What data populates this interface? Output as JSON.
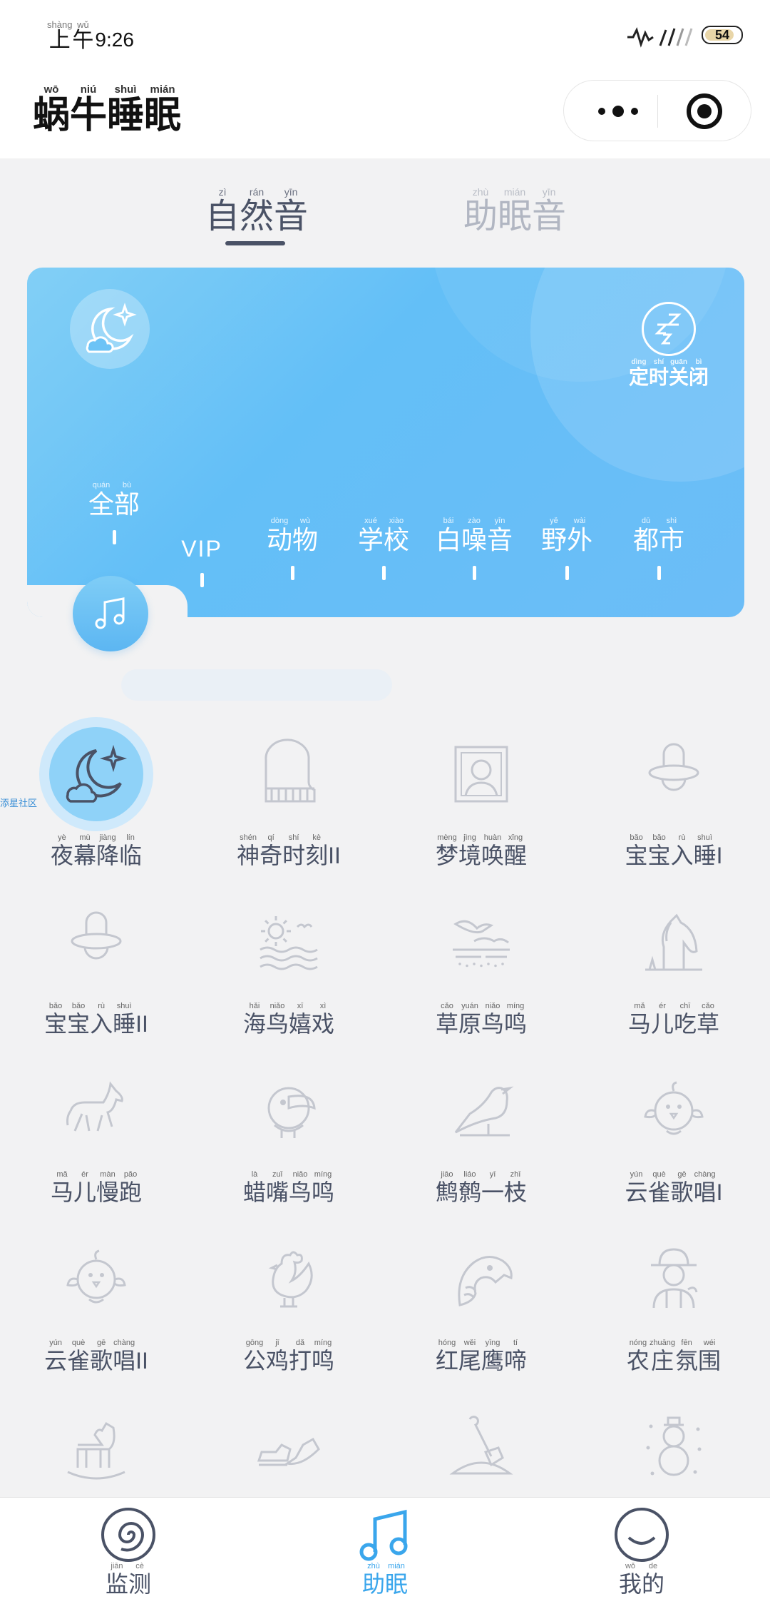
{
  "status": {
    "time_prefix": "上午",
    "time_prefix_pinyin": [
      "shàng",
      "wǔ"
    ],
    "time": "9:26",
    "battery": "54"
  },
  "header": {
    "title_chars": [
      "蜗",
      "牛",
      "睡",
      "眠"
    ],
    "title_pinyin": [
      "wō",
      "niú",
      "shuì",
      "mián"
    ]
  },
  "tabs": [
    {
      "chars": [
        "自",
        "然",
        "音"
      ],
      "pinyin": [
        "zì",
        "rán",
        "yīn"
      ],
      "active": true
    },
    {
      "chars": [
        "助",
        "眠",
        "音"
      ],
      "pinyin": [
        "zhù",
        "mián",
        "yīn"
      ],
      "active": false
    }
  ],
  "card": {
    "timer": {
      "chars": [
        "定",
        "时",
        "关",
        "闭"
      ],
      "pinyin": [
        "dìng",
        "shí",
        "guān",
        "bì"
      ]
    },
    "categories": [
      {
        "chars": [
          "全",
          "部"
        ],
        "pinyin": [
          "quán",
          "bù"
        ],
        "active": true
      },
      {
        "chars": [
          "VIP"
        ],
        "pinyin": [
          ""
        ],
        "active": false
      },
      {
        "chars": [
          "动",
          "物"
        ],
        "pinyin": [
          "dòng",
          "wù"
        ],
        "active": false
      },
      {
        "chars": [
          "学",
          "校"
        ],
        "pinyin": [
          "xué",
          "xiào"
        ],
        "active": false
      },
      {
        "chars": [
          "白",
          "噪",
          "音"
        ],
        "pinyin": [
          "bái",
          "zào",
          "yīn"
        ],
        "active": false
      },
      {
        "chars": [
          "野",
          "外"
        ],
        "pinyin": [
          "yě",
          "wài"
        ],
        "active": false
      },
      {
        "chars": [
          "都",
          "市"
        ],
        "pinyin": [
          "dū",
          "shì"
        ],
        "active": false
      }
    ]
  },
  "side_link": "添星社区",
  "sounds": [
    {
      "icon": "moon-icon",
      "chars": [
        "夜",
        "幕",
        "降",
        "临"
      ],
      "pinyin": [
        "yè",
        "mù",
        "jiàng",
        "lín"
      ],
      "active": true
    },
    {
      "icon": "piano-icon",
      "chars": [
        "神",
        "奇",
        "时",
        "刻",
        " II"
      ],
      "pinyin": [
        "shén",
        "qí",
        "shí",
        "kè",
        ""
      ]
    },
    {
      "icon": "portrait-icon",
      "chars": [
        "梦",
        "境",
        "唤",
        "醒"
      ],
      "pinyin": [
        "mèng",
        "jìng",
        "huàn",
        "xǐng"
      ]
    },
    {
      "icon": "pacifier-icon",
      "chars": [
        "宝",
        "宝",
        "入",
        "睡",
        " I"
      ],
      "pinyin": [
        "bǎo",
        "bǎo",
        "rù",
        "shuì",
        ""
      ]
    },
    {
      "icon": "pacifier-icon",
      "chars": [
        "宝",
        "宝",
        "入",
        "睡",
        " II"
      ],
      "pinyin": [
        "bǎo",
        "bǎo",
        "rù",
        "shuì",
        ""
      ]
    },
    {
      "icon": "seaside-icon",
      "chars": [
        "海",
        "鸟",
        "嬉",
        "戏"
      ],
      "pinyin": [
        "hǎi",
        "niǎo",
        "xī",
        "xì"
      ]
    },
    {
      "icon": "grassland-bird-icon",
      "chars": [
        "草",
        "原",
        "鸟",
        "鸣"
      ],
      "pinyin": [
        "cǎo",
        "yuán",
        "niǎo",
        "míng"
      ]
    },
    {
      "icon": "horse-head-icon",
      "chars": [
        "马",
        "儿",
        "吃",
        "草"
      ],
      "pinyin": [
        "mǎ",
        "ér",
        "chī",
        "cǎo"
      ]
    },
    {
      "icon": "running-horse-icon",
      "chars": [
        "马",
        "儿",
        "慢",
        "跑"
      ],
      "pinyin": [
        "mǎ",
        "ér",
        "màn",
        "pǎo"
      ]
    },
    {
      "icon": "toucan-icon",
      "chars": [
        "蜡",
        "嘴",
        "鸟",
        "鸣"
      ],
      "pinyin": [
        "là",
        "zuǐ",
        "niǎo",
        "míng"
      ]
    },
    {
      "icon": "magpie-icon",
      "chars": [
        "鹪",
        "鹩",
        "一",
        "枝"
      ],
      "pinyin": [
        "jiāo",
        "liáo",
        "yī",
        "zhī"
      ]
    },
    {
      "icon": "chick-icon",
      "chars": [
        "云",
        "雀",
        "歌",
        "唱",
        " I"
      ],
      "pinyin": [
        "yún",
        "què",
        "gē",
        "chàng",
        ""
      ]
    },
    {
      "icon": "chick-icon",
      "chars": [
        "云",
        "雀",
        "歌",
        "唱",
        " II"
      ],
      "pinyin": [
        "yún",
        "què",
        "gē",
        "chàng",
        ""
      ]
    },
    {
      "icon": "rooster-icon",
      "chars": [
        "公",
        "鸡",
        "打",
        "鸣"
      ],
      "pinyin": [
        "gōng",
        "jī",
        "dǎ",
        "míng"
      ]
    },
    {
      "icon": "eagle-icon",
      "chars": [
        "红",
        "尾",
        "鹰",
        "啼"
      ],
      "pinyin": [
        "hóng",
        "wěi",
        "yīng",
        "tí"
      ]
    },
    {
      "icon": "farmer-icon",
      "chars": [
        "农",
        "庄",
        "氛",
        "围"
      ],
      "pinyin": [
        "nóng",
        "zhuāng",
        "fēn",
        "wéi"
      ]
    },
    {
      "icon": "rocking-horse-icon",
      "chars": [],
      "pinyin": []
    },
    {
      "icon": "sneakers-icon",
      "chars": [],
      "pinyin": []
    },
    {
      "icon": "shovel-icon",
      "chars": [],
      "pinyin": []
    },
    {
      "icon": "snowman-icon",
      "chars": [],
      "pinyin": []
    }
  ],
  "bottom_nav": [
    {
      "icon": "spiral-icon",
      "chars": [
        "监",
        "测"
      ],
      "pinyin": [
        "jiān",
        "cè"
      ],
      "active": false
    },
    {
      "icon": "music-note-icon",
      "chars": [
        "助",
        "眠"
      ],
      "pinyin": [
        "zhù",
        "mián"
      ],
      "active": true
    },
    {
      "icon": "smile-icon",
      "chars": [
        "我",
        "的"
      ],
      "pinyin": [
        "wǒ",
        "de"
      ],
      "active": false
    }
  ],
  "colors": {
    "accent": "#3aa6ec",
    "card": "#63bff7",
    "text": "#4a5266",
    "icon_gray": "#c4c7cf"
  }
}
